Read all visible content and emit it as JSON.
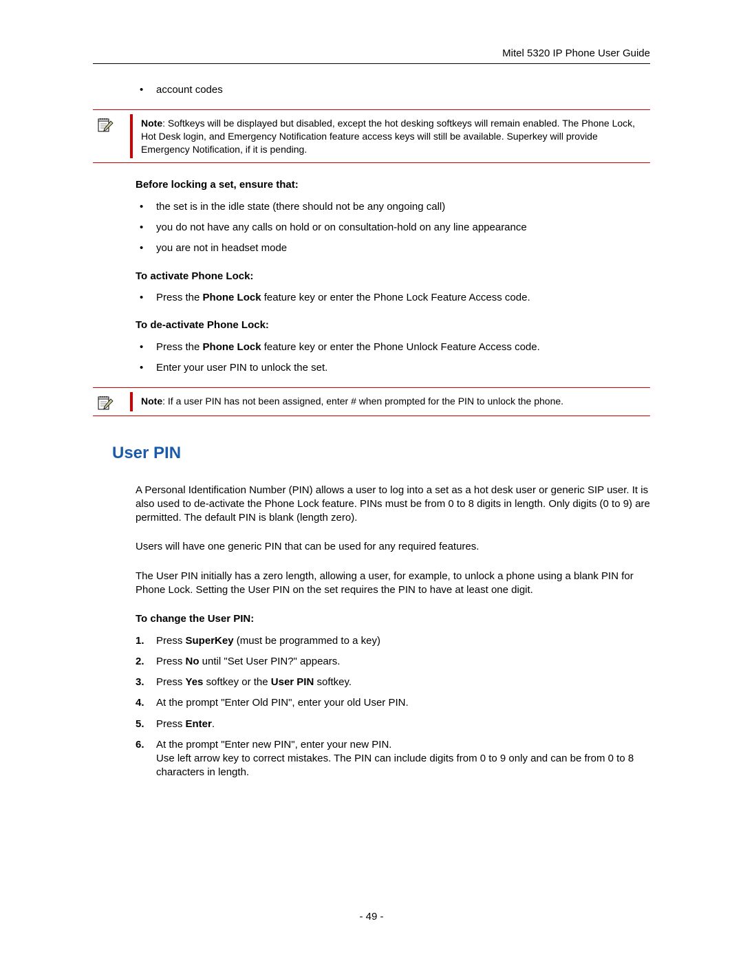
{
  "header": {
    "title": "Mitel 5320 IP Phone User Guide"
  },
  "bullets_top": [
    "account codes"
  ],
  "note1": {
    "prefix": "Note",
    "text": ": Softkeys will be displayed but disabled, except the hot desking softkeys will remain enabled. The Phone Lock, Hot Desk login, and Emergency Notification feature access keys will still be available. Superkey will provide Emergency Notification, if it is pending."
  },
  "subhead1": "Before locking a set, ensure that:",
  "bullets1": [
    "the set is in the idle state (there should not be any ongoing call)",
    "you do not have any calls on hold or on consultation-hold on any line appearance",
    "you are not in headset mode"
  ],
  "subhead2": "To activate Phone Lock:",
  "bullets2_pre": "Press the ",
  "bullets2_bold": "Phone Lock",
  "bullets2_post": " feature key or enter the Phone Lock Feature Access code.",
  "subhead3": "To de-activate Phone Lock:",
  "bullets3a_pre": "Press the ",
  "bullets3a_bold": "Phone Lock",
  "bullets3a_post": " feature key or enter the Phone Unlock Feature Access code.",
  "bullets3b": "Enter your user PIN to unlock the set.",
  "note2": {
    "prefix": "Note",
    "text": ": If a user PIN has not been assigned, enter # when prompted for the PIN to unlock the phone."
  },
  "section_title": "User PIN",
  "para1": "A Personal Identification Number (PIN) allows a user to log into a set as a hot desk user or generic SIP user. It is also used to de-activate the Phone Lock feature. PINs must be from 0 to 8 digits in length. Only digits (0 to 9) are permitted. The default PIN is blank (length zero).",
  "para2": "Users will have one generic PIN that can be used for any required features.",
  "para3": "The User PIN initially has a zero length, allowing a user, for example, to unlock a phone using a blank PIN for Phone Lock. Setting the User PIN on the set requires the PIN to have at least one digit.",
  "subhead4": "To change the User PIN:",
  "steps": {
    "s1_pre": "Press ",
    "s1_b": "SuperKey",
    "s1_post": " (must be programmed to a key)",
    "s2_pre": "Press ",
    "s2_b": "No",
    "s2_post": " until \"Set User PIN?\" appears.",
    "s3_pre": "Press ",
    "s3_b1": "Yes",
    "s3_mid": " softkey or the ",
    "s3_b2": "User PIN",
    "s3_post": " softkey.",
    "s4": "At the prompt \"Enter Old PIN\", enter your old User PIN.",
    "s5_pre": "Press ",
    "s5_b": "Enter",
    "s5_post": ".",
    "s6_line1": "At the prompt \"Enter new PIN\", enter your new PIN.",
    "s6_line2": "Use left arrow key to correct mistakes. The PIN can include digits from 0 to 9 only and can be from 0 to 8 characters in length."
  },
  "page_number": "- 49 -"
}
